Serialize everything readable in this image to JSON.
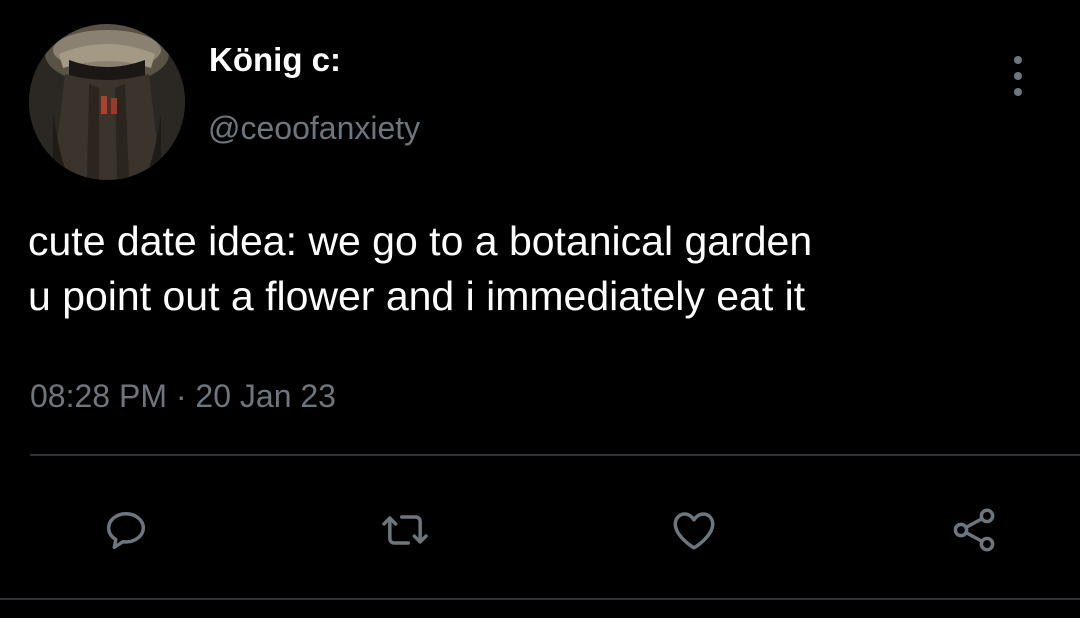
{
  "user": {
    "display_name": "König c:",
    "handle": "@ceoofanxiety"
  },
  "tweet": {
    "lines": [
      "cute date idea: we go to a botanical garden",
      "u point out a flower and i immediately eat it"
    ],
    "time": "08:28 PM",
    "separator": "·",
    "date": "20 Jan 23"
  },
  "actions": [
    "reply-icon",
    "retweet-icon",
    "like-icon",
    "share-icon"
  ],
  "colors": {
    "background": "#000000",
    "text": "#ffffff",
    "secondary": "#6e767d",
    "divider": "#2f3336"
  }
}
